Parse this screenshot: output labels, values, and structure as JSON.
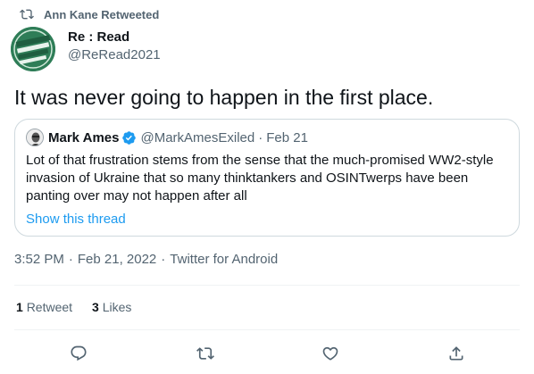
{
  "retweet": {
    "icon": "retweet-icon",
    "label": "Ann Kane Retweeted"
  },
  "tweet": {
    "author_name": "Re : Read",
    "author_handle": "@ReRead2021",
    "avatar_icon": "green-logo-avatar",
    "text": "It was never going to happen in the first place."
  },
  "quote": {
    "author_name": "Mark Ames",
    "verified_icon": "verified-badge-icon",
    "author_handle": "@MarkAmesExiled",
    "separator": "·",
    "date": "Feb 21",
    "text": "Lot of that frustration stems from the sense that the much-promised WW2-style invasion of Ukraine that so many thinktankers and OSINTwerps have been panting over may not happen after all",
    "show_thread": "Show this thread"
  },
  "meta": {
    "time": "3:52 PM",
    "sep1": "·",
    "date": "Feb 21, 2022",
    "sep2": "·",
    "client": "Twitter for Android"
  },
  "stats": {
    "retweets_count": "1",
    "retweets_label": "Retweet",
    "likes_count": "3",
    "likes_label": "Likes"
  },
  "actions": [
    "reply-icon",
    "retweet-icon",
    "like-icon",
    "share-icon"
  ],
  "colors": {
    "accent": "#1d9bf0",
    "secondary_text": "#536471",
    "border": "#cfd9de",
    "avatar_green": "#2e7d57"
  }
}
